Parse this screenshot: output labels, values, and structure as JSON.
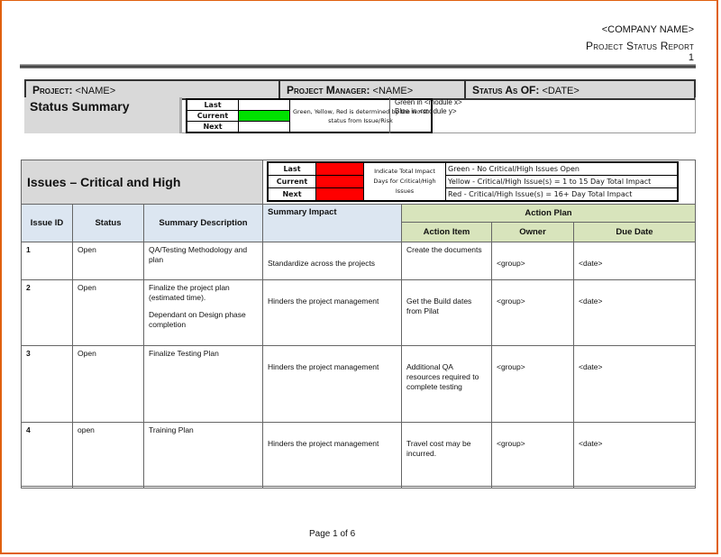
{
  "header": {
    "company": "<COMPANY NAME>",
    "report_title": "Project Status Report",
    "page_number": "1"
  },
  "project_bar": {
    "project_label": "Project:",
    "project_value": "<NAME>",
    "manager_label": "Project Manager:",
    "manager_value": "<NAME>",
    "status_as_of_label": "Status As OF:",
    "status_as_of_value": "<DATE>"
  },
  "status_summary": {
    "title": "Status Summary",
    "rows": [
      {
        "label": "Last",
        "color": "#ffffff"
      },
      {
        "label": "Current",
        "color": "#00e000"
      },
      {
        "label": "Next",
        "color": "#ffffff"
      }
    ],
    "note": "Green, Yellow, Red is determined by the worst status from Issue/Risk",
    "legend_lines": [
      "Green in <module x>",
      "Blue in <module y>"
    ]
  },
  "issues": {
    "title": "Issues – Critical and High",
    "impact_rows": [
      {
        "label": "Last",
        "color": "#ff0000"
      },
      {
        "label": "Current",
        "color": "#ff0000"
      },
      {
        "label": "Next",
        "color": "#ff0000"
      }
    ],
    "impact_note": "Indicate Total Impact Days for Critical/High Issues",
    "impact_legend": [
      "Green - No Critical/High Issues Open",
      "Yellow - Critical/High Issue(s) = 1 to 15 Day Total Impact",
      "Red - Critical/High Issue(s) = 16+ Day Total Impact"
    ],
    "columns": {
      "issue_id": "Issue ID",
      "status": "Status",
      "summary_description": "Summary Description",
      "summary_impact": "Summary Impact",
      "action_plan": "Action Plan",
      "action_item": "Action Item",
      "owner": "Owner",
      "due_date": "Due Date"
    },
    "rows": [
      {
        "id": "1",
        "status": "Open",
        "desc": "QA/Testing Methodology and plan",
        "desc2": "",
        "impact": "Standardize across the projects",
        "action": "Create the documents",
        "owner": "<group>",
        "due": "<date>"
      },
      {
        "id": "2",
        "status": "Open",
        "desc": "Finalize the project plan (estimated time).",
        "desc2": "Dependant on Design phase completion",
        "impact": "Hinders the project  management",
        "action": "Get the Build dates from Pilat",
        "owner": "<group>",
        "due": "<date>"
      },
      {
        "id": "3",
        "status": "Open",
        "desc": "Finalize Testing Plan",
        "desc2": "",
        "impact": "Hinders the project  management",
        "action": "Additional QA resources required to complete testing",
        "owner": "<group>",
        "due": "<date>"
      },
      {
        "id": "4",
        "status": "open",
        "desc": "Training Plan",
        "desc2": "",
        "impact": "Hinders the project  management",
        "action": "Travel cost may be incurred.",
        "owner": "<group>",
        "due": "<date>"
      }
    ]
  },
  "footer": {
    "page_label": "Page 1 of 6"
  }
}
